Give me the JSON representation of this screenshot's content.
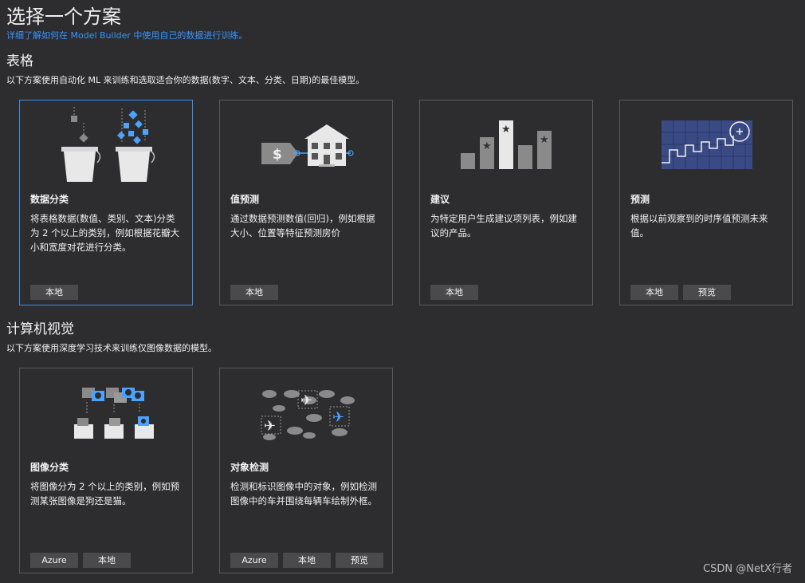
{
  "page": {
    "title": "选择一个方案",
    "learn_link": "详细了解如何在 Model Builder 中使用自己的数据进行训练。"
  },
  "sections": [
    {
      "title": "表格",
      "description": "以下方案使用自动化 ML 来训练和选取适合你的数据(数字、文本、分类、日期)的最佳模型。",
      "cards": [
        {
          "title": "数据分类",
          "description": "将表格数据(数值、类别、文本)分类为 2 个以上的类别，例如根据花瓣大小和宽度对花进行分类。",
          "tags": [
            "本地"
          ],
          "icon": "buckets-icon"
        },
        {
          "title": "值预测",
          "description": "通过数据预测数值(回归)，例如根据大小、位置等特征预测房价",
          "tags": [
            "本地"
          ],
          "icon": "house-price-icon"
        },
        {
          "title": "建议",
          "description": "为特定用户生成建议项列表，例如建议的产品。",
          "tags": [
            "本地"
          ],
          "icon": "bar-stars-icon"
        },
        {
          "title": "预测",
          "description": "根据以前观察到的时序值预测未来值。",
          "tags": [
            "本地",
            "预览"
          ],
          "icon": "timeseries-icon"
        }
      ]
    },
    {
      "title": "计算机视觉",
      "description": "以下方案使用深度学习技术来训练仅图像数据的模型。",
      "cards": [
        {
          "title": "图像分类",
          "description": "将图像分为 2 个以上的类别，例如预测某张图像是狗还是猫。",
          "tags": [
            "Azure",
            "本地"
          ],
          "icon": "image-folders-icon"
        },
        {
          "title": "对象检测",
          "description": "检测和标识图像中的对象，例如检测图像中的车并围绕每辆车绘制外框。",
          "tags": [
            "Azure",
            "本地",
            "预览"
          ],
          "icon": "airplanes-clouds-icon"
        }
      ]
    }
  ],
  "watermark": "CSDN @NetX行者",
  "colors": {
    "accent": "#3794ff",
    "selected_border": "#3d8ee0",
    "background": "#2d2d30"
  }
}
